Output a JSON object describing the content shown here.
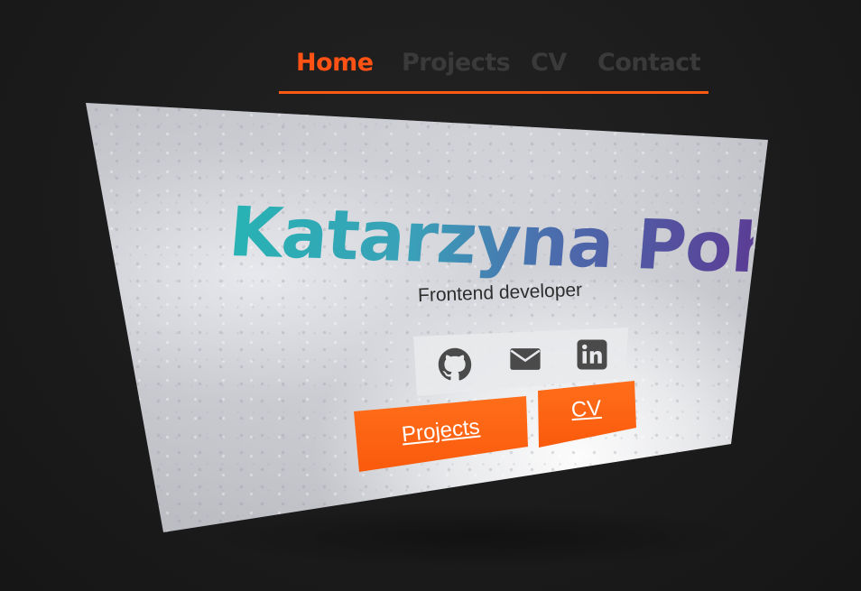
{
  "nav": {
    "items": [
      {
        "label": "Home",
        "active": true
      },
      {
        "label": "Projects",
        "active": false
      },
      {
        "label": "CV",
        "active": false
      },
      {
        "label": "Contact",
        "active": false
      }
    ],
    "accent_color": "#ff5214"
  },
  "hero": {
    "name": "Katarzyna Pohl",
    "subtitle": "Frontend developer",
    "social_icons": [
      "github-icon",
      "mail-icon",
      "linkedin-icon"
    ],
    "buttons": {
      "projects": "Projects",
      "cv": "CV"
    }
  }
}
